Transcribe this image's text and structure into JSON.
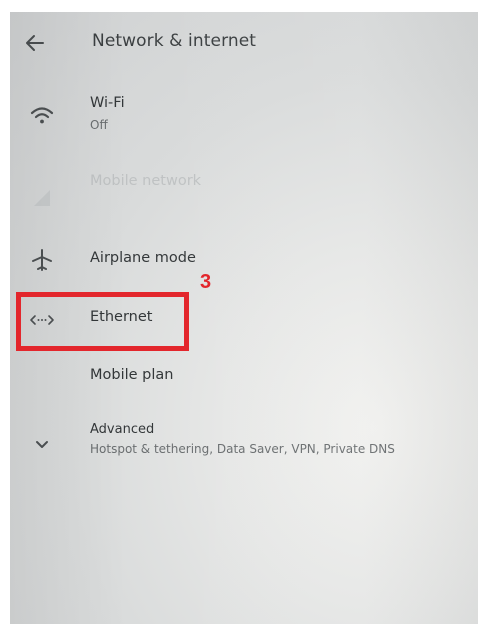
{
  "header": {
    "title": "Network & internet",
    "back_icon": "arrow-back-icon"
  },
  "items": [
    {
      "id": "wifi",
      "label": "Wi-Fi",
      "sub": "Off",
      "icon": "wifi-icon",
      "enabled": true
    },
    {
      "id": "mobile",
      "label": "Mobile network",
      "sub": "",
      "icon": "cellular-signal-icon",
      "enabled": false
    },
    {
      "id": "airplane",
      "label": "Airplane mode",
      "sub": "",
      "icon": "airplane-icon",
      "enabled": true
    },
    {
      "id": "ethernet",
      "label": "Ethernet",
      "sub": "",
      "icon": "ethernet-icon",
      "enabled": true
    },
    {
      "id": "mobile_plan",
      "label": "Mobile plan",
      "sub": "",
      "icon": "",
      "enabled": true
    },
    {
      "id": "advanced",
      "label": "Advanced",
      "sub": "Hotspot & tethering, Data Saver, VPN, Private DNS",
      "icon": "chevron-down-icon",
      "enabled": true
    }
  ],
  "annotation": {
    "step_number": "3",
    "color": "#e3262c"
  }
}
